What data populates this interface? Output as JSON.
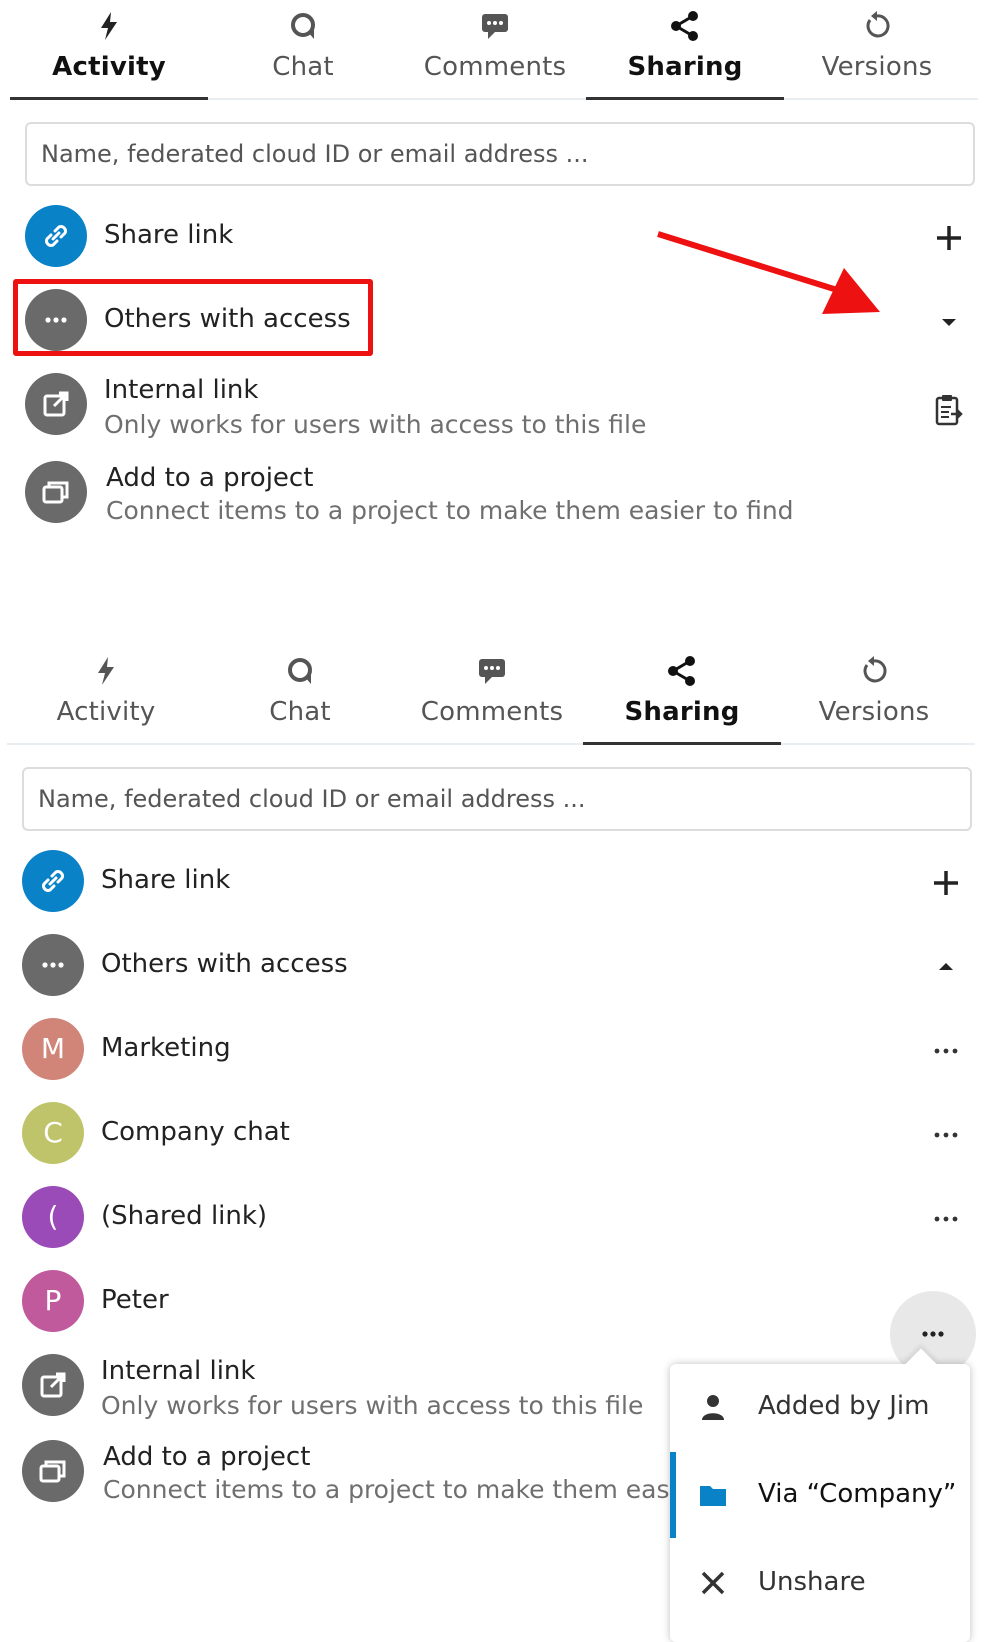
{
  "colors": {
    "accent_blue": "#0a82c8",
    "grey_avatar": "#6a6a6a",
    "annotation_red": "#ee1111",
    "marketing": "#d08578",
    "company_chat": "#bfc46a",
    "shared_link": "#9b4bb8",
    "peter": "#c05a9d"
  },
  "tabs": [
    {
      "label": "Activity",
      "icon": "lightning-icon"
    },
    {
      "label": "Chat",
      "icon": "chat-bubble-icon"
    },
    {
      "label": "Comments",
      "icon": "comment-icon"
    },
    {
      "label": "Sharing",
      "icon": "share-icon"
    },
    {
      "label": "Versions",
      "icon": "history-icon"
    }
  ],
  "active_tab": "Sharing",
  "search": {
    "placeholder": "Name, federated cloud ID or email address ..."
  },
  "share_link": {
    "label": "Share link"
  },
  "others_with_access": {
    "label": "Others with access"
  },
  "internal_link": {
    "label": "Internal link",
    "description": "Only works for users with access to this file"
  },
  "add_project": {
    "label": "Add to a project",
    "description": "Connect items to a project to make them easier to find",
    "description_truncated": "Connect items to a project to make them easi"
  },
  "shares": [
    {
      "initial": "M",
      "name": "Marketing",
      "color": "#d08578"
    },
    {
      "initial": "C",
      "name": "Company chat",
      "color": "#bfc46a"
    },
    {
      "initial": "(",
      "name": "(Shared link)",
      "color": "#9b4bb8"
    },
    {
      "initial": "P",
      "name": "Peter",
      "color": "#c05a9d"
    }
  ],
  "menu": {
    "added_by": "Added by Jim",
    "via": "Via “Company”",
    "unshare": "Unshare"
  }
}
